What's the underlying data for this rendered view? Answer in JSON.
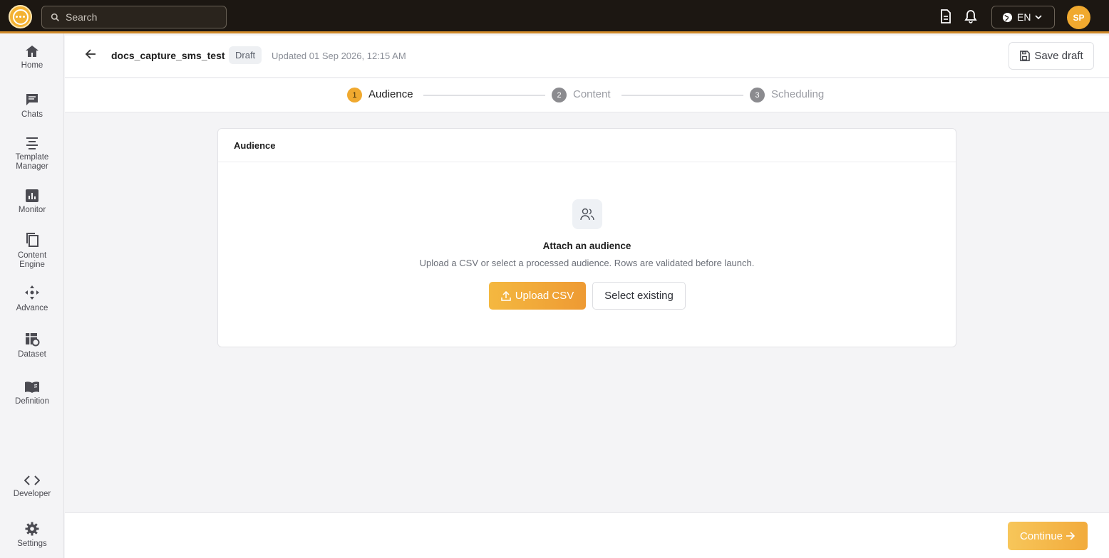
{
  "topbar": {
    "search_placeholder": "Search",
    "language": "EN",
    "avatar_initials": "SP"
  },
  "sidebar": {
    "items": [
      {
        "label": "Home",
        "icon": "home-icon"
      },
      {
        "label": "Chats",
        "icon": "chat-icon"
      },
      {
        "label": "Template Manager",
        "icon": "template-icon"
      },
      {
        "label": "Monitor",
        "icon": "chart-icon"
      },
      {
        "label": "Content Engine",
        "icon": "copy-icon"
      },
      {
        "label": "Advance",
        "icon": "move-icon"
      },
      {
        "label": "Dataset",
        "icon": "dataset-icon"
      },
      {
        "label": "Definition",
        "icon": "book-icon"
      },
      {
        "label": "Developer",
        "icon": "code-icon"
      },
      {
        "label": "Settings",
        "icon": "gear-icon"
      }
    ]
  },
  "header": {
    "campaign_name": "docs_capture_sms_test",
    "status": "Draft",
    "updated": "Updated 01 Sep 2026, 12:15 AM",
    "save_label": "Save draft"
  },
  "stepper": {
    "steps": [
      {
        "number": "1",
        "label": "Audience",
        "active": true
      },
      {
        "number": "2",
        "label": "Content",
        "active": false
      },
      {
        "number": "3",
        "label": "Scheduling",
        "active": false
      }
    ]
  },
  "card": {
    "title": "Audience",
    "empty_title": "Attach an audience",
    "empty_desc": "Upload a CSV or select a processed audience. Rows are validated before launch.",
    "upload_label": "Upload CSV",
    "select_label": "Select existing"
  },
  "footer": {
    "continue_label": "Continue"
  },
  "colors": {
    "accent": "#f0a92f",
    "topbar": "#1c1712"
  }
}
